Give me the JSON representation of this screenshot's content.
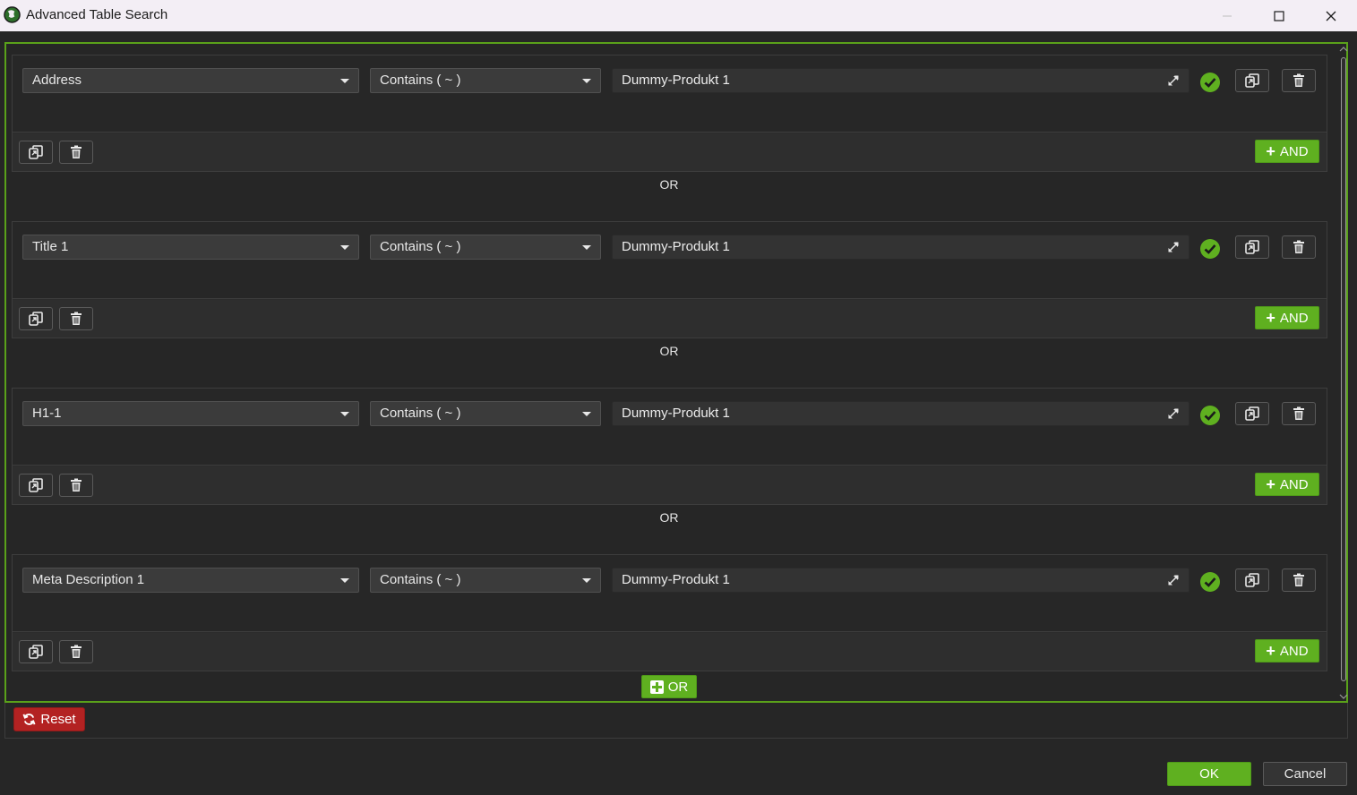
{
  "window": {
    "title": "Advanced Table Search",
    "app_icon": "globe-leaf-icon",
    "controls": [
      "minimize-icon",
      "maximize-icon",
      "close-icon"
    ]
  },
  "groups": [
    {
      "field": "Address",
      "operator": "Contains ( ~ )",
      "value": "Dummy-Produkt 1",
      "and_label": "AND"
    },
    {
      "field": "Title 1",
      "operator": "Contains ( ~ )",
      "value": "Dummy-Produkt 1",
      "and_label": "AND"
    },
    {
      "field": "H1-1",
      "operator": "Contains ( ~ )",
      "value": "Dummy-Produkt 1",
      "and_label": "AND"
    },
    {
      "field": "Meta Description 1",
      "operator": "Contains ( ~ )",
      "value": "Dummy-Produkt 1",
      "and_label": "AND"
    }
  ],
  "separators": [
    "OR",
    "OR",
    "OR"
  ],
  "add_or_label": "OR",
  "reset_label": "Reset",
  "ok_label": "OK",
  "cancel_label": "Cancel",
  "colors": {
    "accent_green": "#5fb020",
    "reset_red": "#b32222",
    "background": "#262626",
    "titlebar": "#f3eef5"
  }
}
